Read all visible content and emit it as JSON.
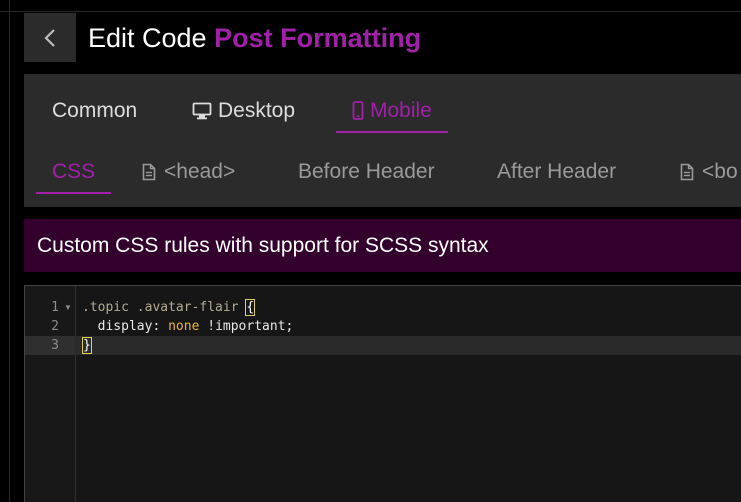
{
  "header": {
    "back_label": "Back",
    "title_prefix": "Edit Code",
    "theme_name": "Post Formatting"
  },
  "target_tabs": [
    {
      "label": "Common",
      "icon": "none",
      "active": false
    },
    {
      "label": "Desktop",
      "icon": "desktop-icon",
      "active": false
    },
    {
      "label": "Mobile",
      "icon": "mobile-icon",
      "active": true
    }
  ],
  "field_tabs": [
    {
      "label": "CSS",
      "icon": "none",
      "active": true
    },
    {
      "label": "<head>",
      "icon": "file-icon",
      "active": false
    },
    {
      "label": "Before Header",
      "icon": "none",
      "active": false
    },
    {
      "label": "After Header",
      "icon": "none",
      "active": false
    },
    {
      "label": "<bo",
      "icon": "file-icon",
      "active": false
    }
  ],
  "banner": {
    "text": "Custom CSS rules with support for SCSS syntax"
  },
  "editor": {
    "line_numbers": [
      "1",
      "2",
      "3"
    ],
    "line1": {
      "selector": ".topic .avatar-flair",
      "brace": "{"
    },
    "line2": {
      "indent": "  ",
      "property": "display",
      "colon": ": ",
      "value": "none",
      "space": " ",
      "important": "!important",
      "semicolon": ";"
    },
    "line3": {
      "brace": "}"
    }
  },
  "colors": {
    "accent": "#a020a8",
    "banner_bg": "#33002d",
    "panel_bg": "#2b2b2b",
    "editor_bg": "#161616",
    "keyword": "#f0b43c"
  }
}
